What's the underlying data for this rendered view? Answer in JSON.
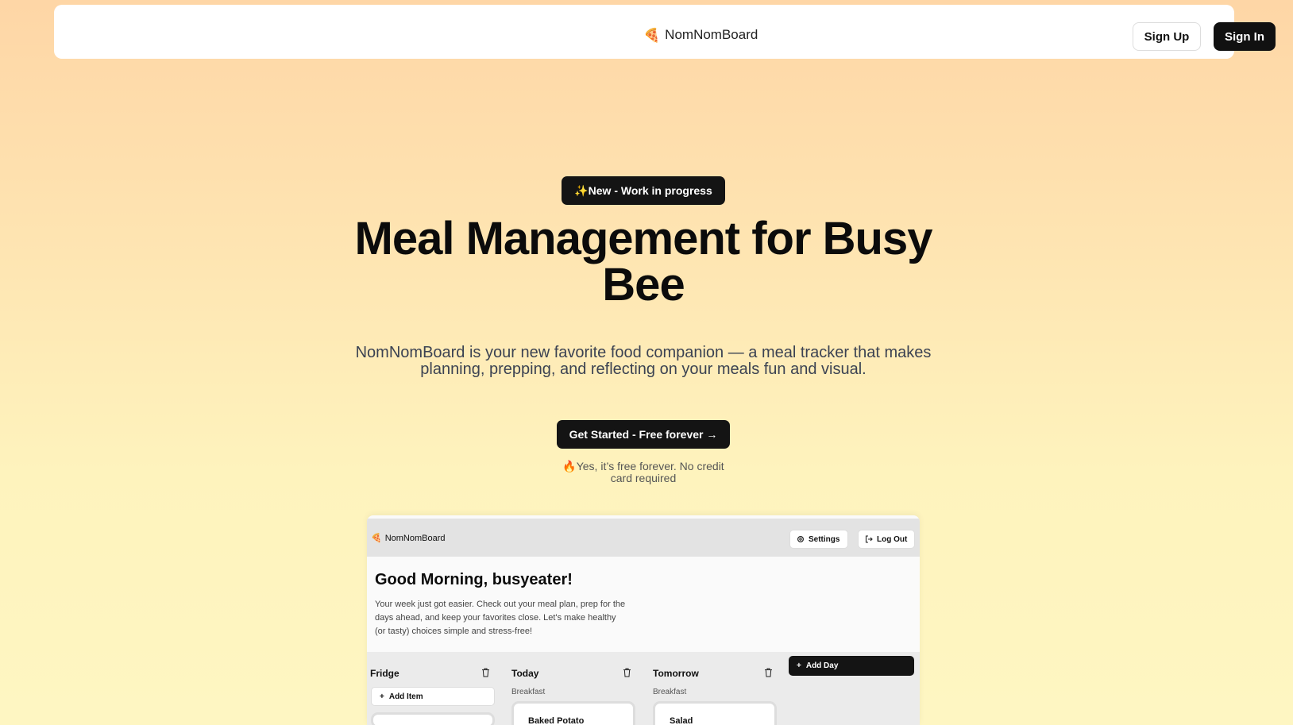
{
  "nav": {
    "brand_icon": "pizza-icon",
    "brand_icon_glyph": "🍕",
    "brand_name": "NomNomBoard",
    "sign_up_label": "Sign Up",
    "sign_in_label": "Sign In"
  },
  "hero": {
    "badge": "✨New - Work in progress",
    "title": "Meal Management for Busy Bee",
    "subtitle": "NomNomBoard is your new favorite food companion — a meal tracker that makes planning, prepping, and reflecting on your meals fun and visual.",
    "cta_label": "Get Started - Free forever →",
    "note": "🔥Yes, it’s free forever. No credit card required"
  },
  "preview": {
    "brand_icon_glyph": "🍕",
    "brand_name": "NomNomBoard",
    "settings_label": "Settings",
    "logout_label": "Log Out",
    "greeting": "Good Morning, busyeater!",
    "intro": "Your week just got easier. Check out your meal plan, prep for the days ahead, and keep your favorites close. Let's make healthy (or tasty) choices simple and stress-free!",
    "columns": [
      {
        "title": "Fridge",
        "add_label": "Add Item"
      },
      {
        "title": "Today",
        "meal_label": "Breakfast",
        "card": "Baked Potato"
      },
      {
        "title": "Tomorrow",
        "meal_label": "Breakfast",
        "card": "Salad"
      }
    ],
    "add_day_label": "Add Day"
  },
  "colors": {
    "accent": "#141414",
    "background_top": "#fed6a6",
    "background_bottom": "#fef6c2"
  }
}
